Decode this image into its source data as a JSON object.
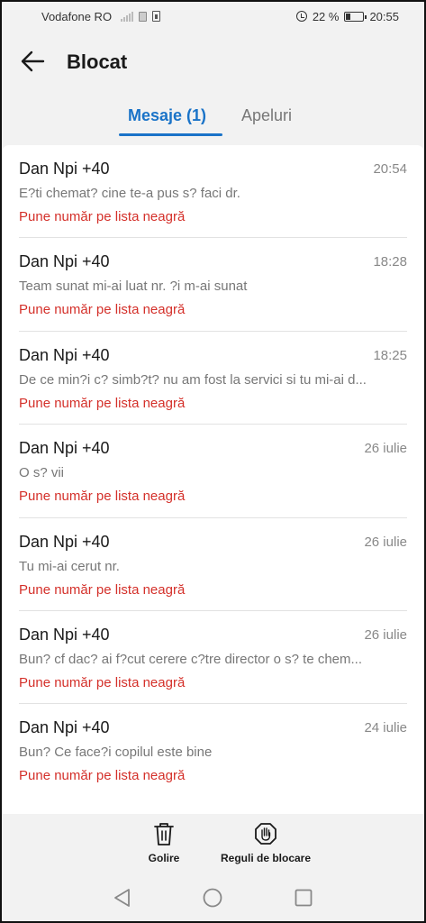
{
  "status_bar": {
    "carrier": "Vodafone RO",
    "battery": "22 %",
    "time": "20:55"
  },
  "header": {
    "title": "Blocat"
  },
  "tabs": [
    {
      "label": "Mesaje (1)",
      "active": true
    },
    {
      "label": "Apeluri",
      "active": false
    }
  ],
  "messages": [
    {
      "name": "Dan Npi +40",
      "time": "20:54",
      "text": "E?ti chemat? cine te-a pus s? faci dr.",
      "action": "Pune număr pe lista neagră"
    },
    {
      "name": "Dan Npi +40",
      "time": "18:28",
      "text": "Team sunat mi-ai luat nr. ?i m-ai sunat",
      "action": "Pune număr pe lista neagră"
    },
    {
      "name": "Dan Npi +40",
      "time": "18:25",
      "text": "De ce min?i c? simb?t? nu am fost la servici si tu mi-ai d...",
      "action": "Pune număr pe lista neagră"
    },
    {
      "name": "Dan Npi +40",
      "time": "26 iulie",
      "text": "O s? vii",
      "action": "Pune număr pe lista neagră"
    },
    {
      "name": "Dan Npi +40",
      "time": "26 iulie",
      "text": "Tu mi-ai cerut nr.",
      "action": "Pune număr pe lista neagră"
    },
    {
      "name": "Dan Npi +40",
      "time": "26 iulie",
      "text": "Bun? cf dac? ai f?cut cerere c?tre director o s? te chem...",
      "action": "Pune număr pe lista neagră"
    },
    {
      "name": "Dan Npi +40",
      "time": "24 iulie",
      "text": "Bun? Ce face?i copilul este bine",
      "action": "Pune număr pe lista neagră"
    }
  ],
  "bottom_bar": {
    "clear_label": "Golire",
    "rules_label": "Reguli de blocare"
  },
  "icons": {
    "back": "arrow-left-icon",
    "clear": "trash-icon",
    "rules": "hand-stop-icon",
    "nav_back": "triangle-back-icon",
    "nav_home": "circle-home-icon",
    "nav_recent": "square-recent-icon"
  },
  "colors": {
    "accent": "#1a73c8",
    "danger": "#d4302a",
    "background": "#f2f2f2"
  }
}
